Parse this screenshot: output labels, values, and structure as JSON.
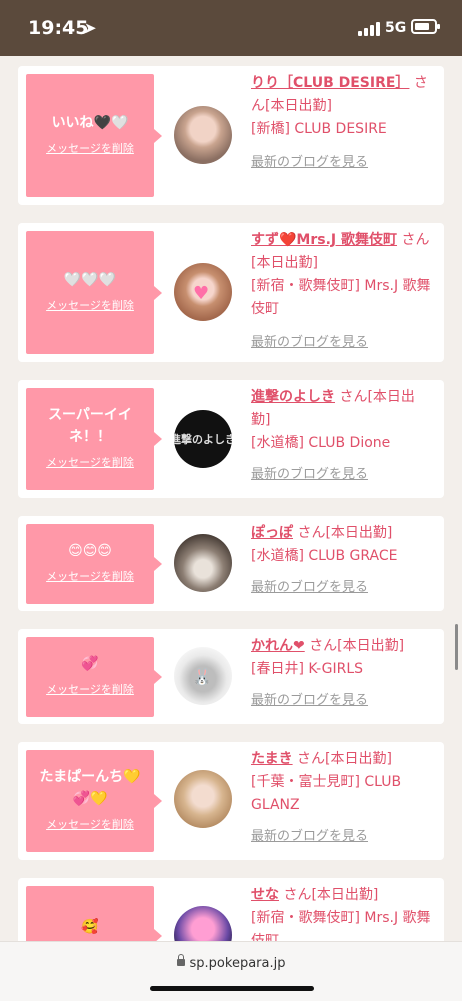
{
  "status": {
    "time": "19:45",
    "network": "5G"
  },
  "browser": {
    "url": "sp.pokepara.jp"
  },
  "common": {
    "delete_label": "メッセージを削除",
    "blog_label": "最新のブログを見る",
    "honorific": "さん[本日出勤]"
  },
  "colors": {
    "accent": "#e0506a",
    "bubble": "#ff98a8",
    "statusbar": "#5b4a3c"
  },
  "items": [
    {
      "message": "いいね🖤🤍",
      "name": "りり［CLUB DESIRE］",
      "shop": "[新橋] CLUB DESIRE",
      "show_blog": true
    },
    {
      "message": "🤍🤍🤍",
      "name": "すず❤️Mrs.J 歌舞伎町",
      "shop": "[新宿・歌舞伎町] Mrs.J 歌舞伎町",
      "show_blog": true
    },
    {
      "message": "スーパーイイネ！！",
      "name": "進撃のよしき",
      "shop": "[水道橋] CLUB Dione",
      "show_blog": true,
      "avatar_text": "進撃のよしき"
    },
    {
      "message": "😊😊😊",
      "name": "ぽっぽ",
      "shop": "[水道橋] CLUB GRACE",
      "show_blog": true
    },
    {
      "message": "💞",
      "name": "かれん❤",
      "shop": "[春日井] K-GIRLS",
      "show_blog": true
    },
    {
      "message": "たまぱーんち💛💞💛",
      "name": "たまき",
      "shop": "[千葉・富士見町] CLUB GLANZ",
      "show_blog": true
    },
    {
      "message": "🥰",
      "name": "せな",
      "shop": "[新宿・歌舞伎町] Mrs.J 歌舞伎町",
      "show_blog": false
    }
  ]
}
